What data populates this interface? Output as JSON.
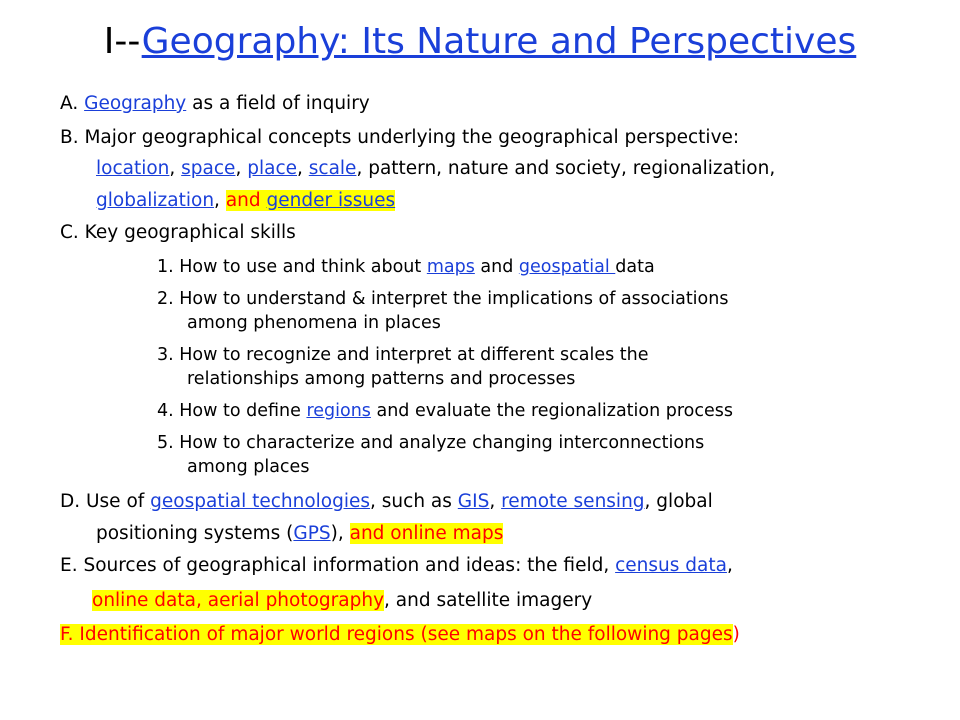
{
  "title": {
    "prefix": "I--",
    "link": "Geography: Its Nature and Perspectives"
  },
  "items": {
    "a": {
      "marker": "A.",
      "link": "Geography",
      "rest": "as a field of inquiry"
    },
    "b": {
      "line1": "B.  Major geographical concepts underlying the geographical perspective:",
      "location": "location",
      "sep1": ", ",
      "space": "space",
      "sep2": ", ",
      "place": "place",
      "sep3": ", ",
      "scale": "scale",
      "rest2": ", pattern, nature and society, regionalization,",
      "globalization": "globalization",
      "sep4": ", ",
      "and": "and ",
      "gender": "gender issues"
    },
    "c": {
      "heading": "C.  Key geographical skills",
      "s1_pre": "1.  How to use and think about ",
      "s1_maps": "maps",
      "s1_and": " and ",
      "s1_geo": "geospatial ",
      "s1_post": "data",
      "s2_l1": "2.  How to understand & interpret the implications of associations",
      "s2_l2": "among phenomena in places",
      "s3_l1": "3.  How to recognize and interpret at different scales the",
      "s3_l2": "relationships among patterns and processes",
      "s4_pre": "4.  How to define ",
      "s4_link": "regions",
      "s4_post": " and evaluate the regionalization process",
      "s5_l1": "5.  How to characterize and analyze changing interconnections",
      "s5_l2": "among places"
    },
    "d": {
      "pre": "D.  Use of ",
      "geotech": "geospatial technologies",
      "mid1": ", such as ",
      "gis": "GIS",
      "mid2": ", ",
      "remote": "remote sensing",
      "post1": ", global",
      "l2_pre": "positioning systems (",
      "gps": "GPS",
      "l2_post": "), ",
      "online_maps": "and online maps "
    },
    "e": {
      "pre": "E.  Sources of geographical information and ideas: the field, ",
      "census": "census data",
      "post": ",",
      "l2_hl": "online data, aerial photography",
      "l2_post": ", and satellite imagery"
    },
    "f": {
      "text": "F.  Identification of major world regions (see maps on the following pages",
      "close": ")"
    }
  },
  "colors": {
    "link": "#1a3fd9",
    "emphasis": "#ff0000",
    "highlight": "#ffff00"
  }
}
